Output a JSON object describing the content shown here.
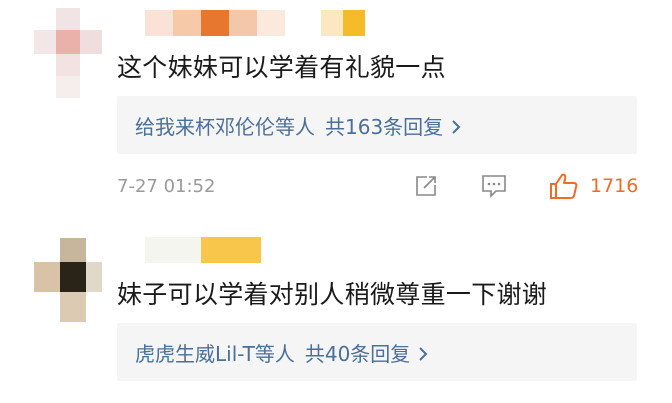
{
  "comments": [
    {
      "content": "这个妹妹可以学着有礼貌一点",
      "reply_users": "给我来杯邓伦伦等人",
      "reply_count": "共163条回复",
      "time": "7-27 01:52",
      "likes": "1716"
    },
    {
      "content": "妹子可以学着对别人稍微尊重一下谢谢",
      "reply_users": "虎虎生威Lil-T等人",
      "reply_count": "共40条回复"
    }
  ],
  "colors": {
    "link": "#4a6f9a",
    "like": "#f26b25",
    "muted": "#9a9a9a"
  },
  "icons": [
    "share-icon",
    "comment-icon",
    "like-icon",
    "chevron-right-icon"
  ]
}
